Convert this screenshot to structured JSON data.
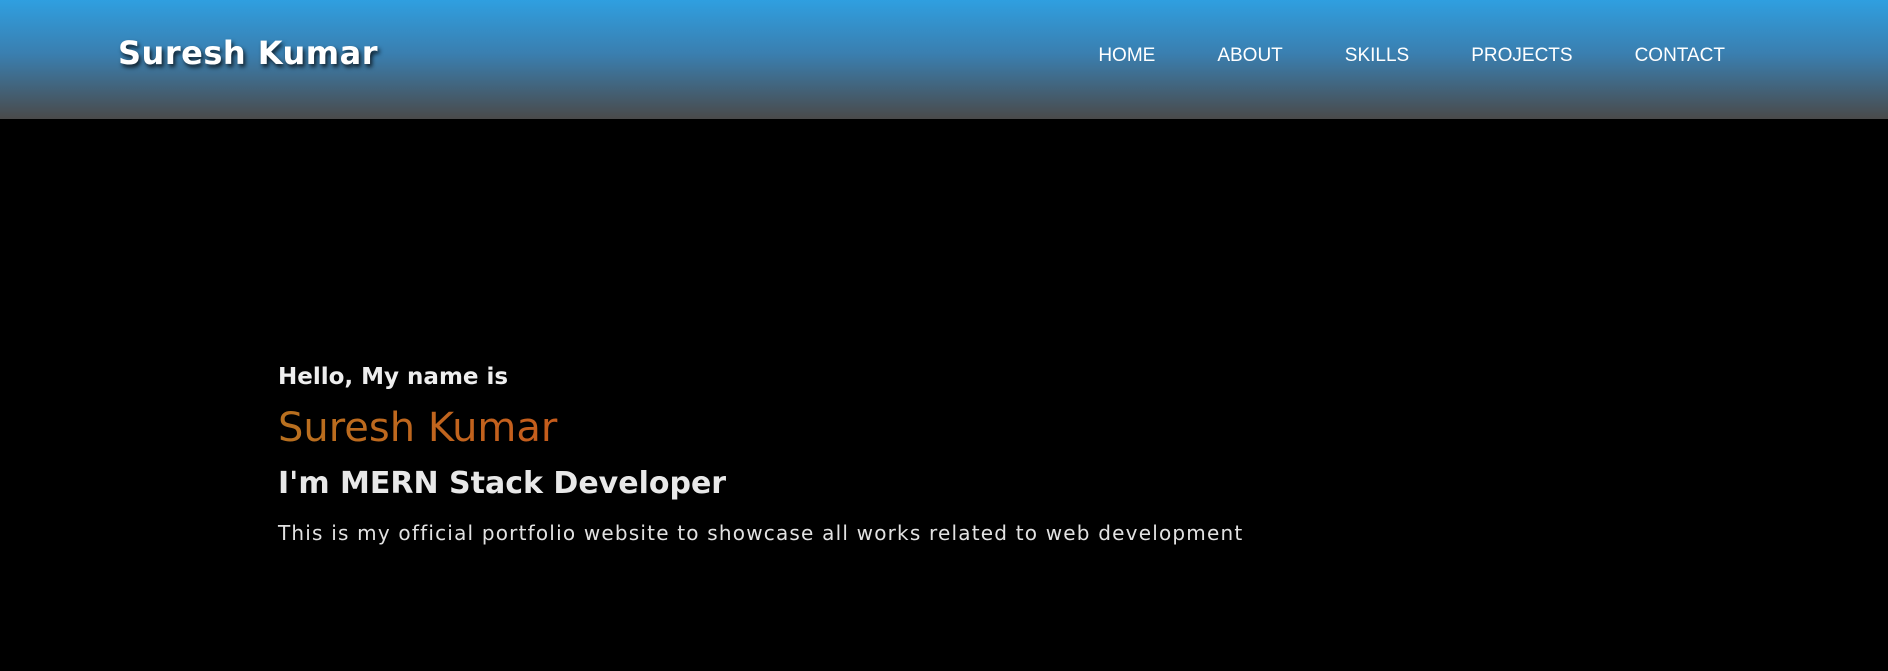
{
  "header": {
    "brand": "Suresh Kumar",
    "nav": [
      {
        "label": "HOME"
      },
      {
        "label": "ABOUT"
      },
      {
        "label": "SKILLS"
      },
      {
        "label": "PROJECTS"
      },
      {
        "label": "CONTACT"
      }
    ]
  },
  "hero": {
    "greeting": "Hello, My name is",
    "name": "Suresh Kumar",
    "role": "I'm MERN Stack Developer",
    "description": "This is my official portfolio website to showcase all works related to web development"
  },
  "colors": {
    "header_top": "#2f9fe0",
    "header_bottom": "#4a4a4a",
    "background": "#000000",
    "name_gradient_start": "#b8701f",
    "name_gradient_end": "#b7281a"
  }
}
